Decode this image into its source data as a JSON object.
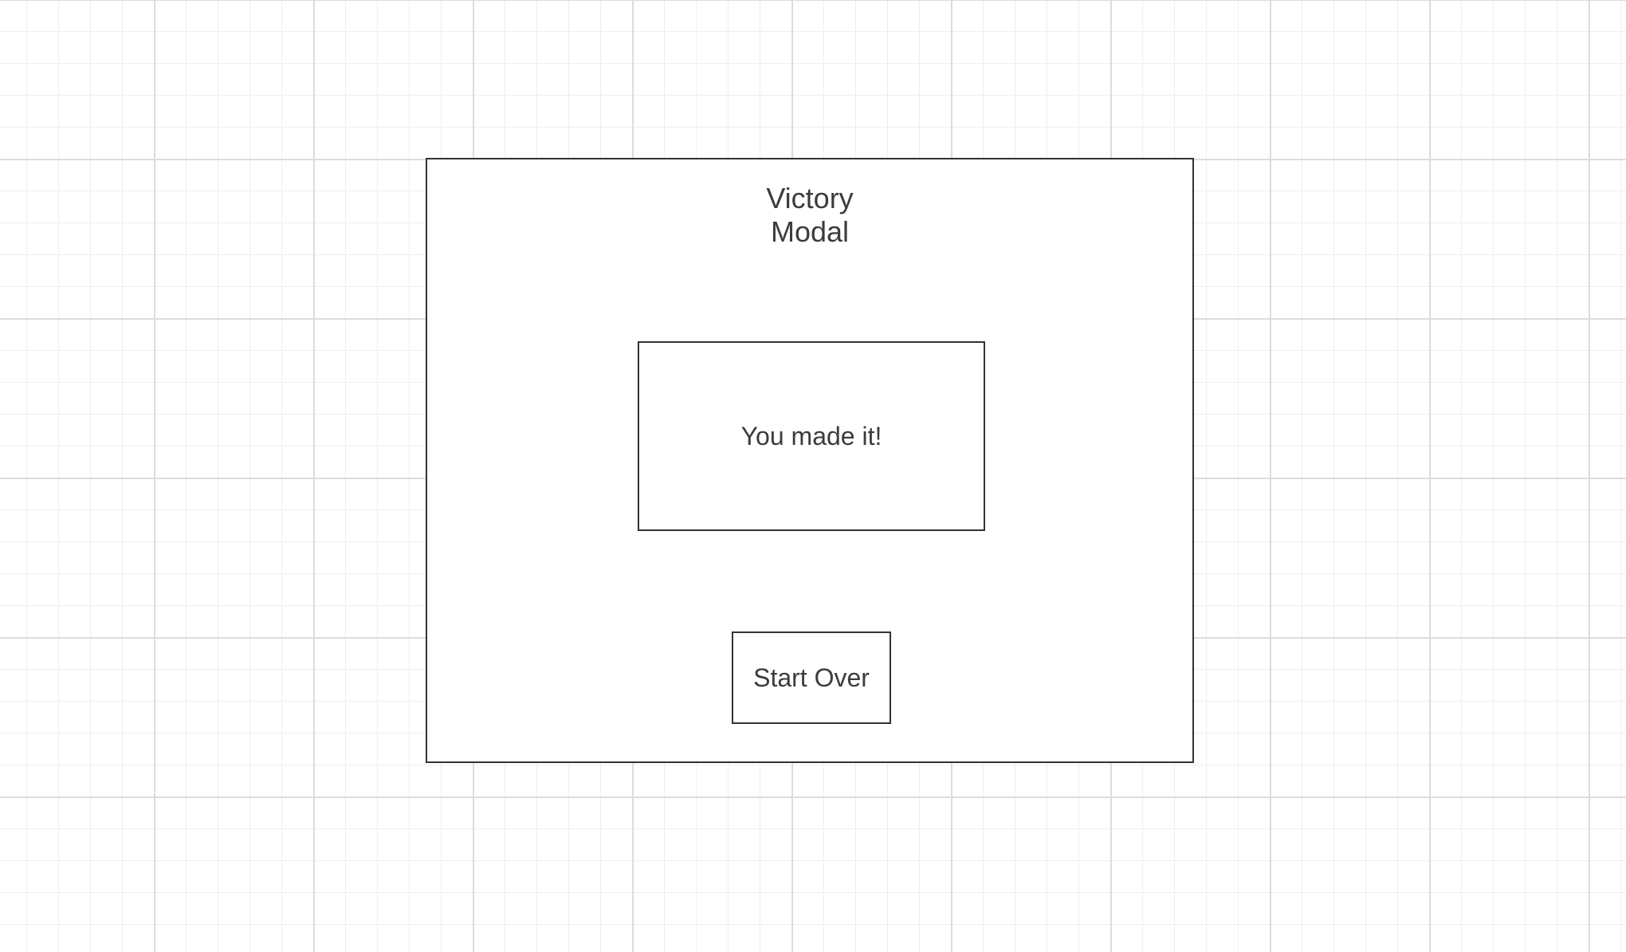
{
  "modal": {
    "title_line1": "Victory",
    "title_line2": "Modal",
    "message": "You made it!",
    "button_label": "Start Over"
  },
  "colors": {
    "border": "#333333",
    "text": "#3c3c3c",
    "grid_major": "#dcdcdc",
    "grid_minor": "#eeeeee",
    "background": "#ffffff"
  }
}
